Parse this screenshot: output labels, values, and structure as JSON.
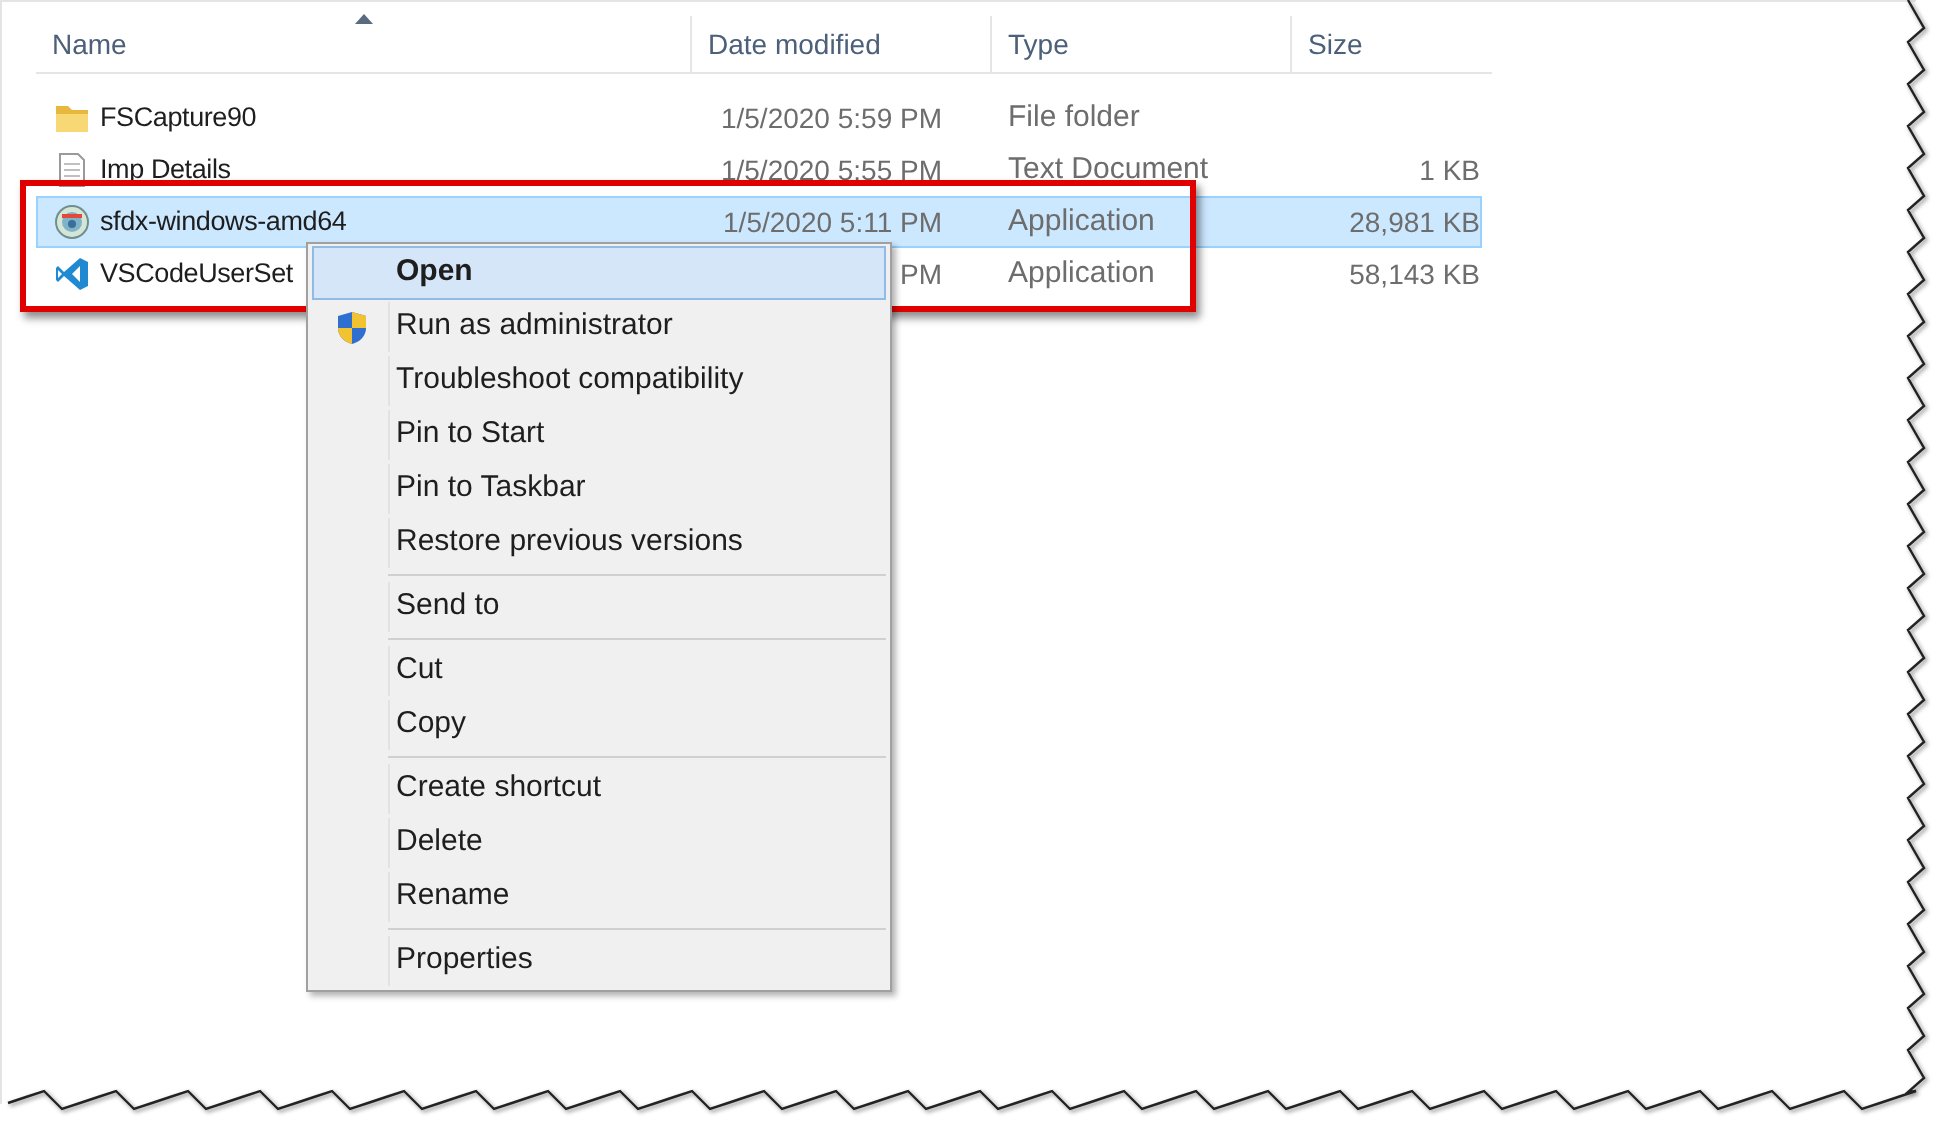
{
  "columns": [
    {
      "label": "Name",
      "sorted": true
    },
    {
      "label": "Date modified",
      "sorted": false
    },
    {
      "label": "Type",
      "sorted": false
    },
    {
      "label": "Size",
      "sorted": false
    }
  ],
  "rows": [
    {
      "kind": "folder",
      "name": "FSCapture90",
      "date": "1/5/2020 5:59 PM",
      "type": "File folder",
      "size": "",
      "selected": false
    },
    {
      "kind": "text",
      "name": "Imp Details",
      "date": "1/5/2020 5:55 PM",
      "type": "Text Document",
      "size": "1 KB",
      "selected": false
    },
    {
      "kind": "installer",
      "name": "sfdx-windows-amd64",
      "date": "1/5/2020 5:11 PM",
      "type": "Application",
      "size": "28,981 KB",
      "selected": true
    },
    {
      "kind": "vscode",
      "name": "VSCodeUserSet",
      "date": "PM",
      "type": "Application",
      "size": "58,143 KB",
      "selected": false
    }
  ],
  "context_menu": [
    {
      "kind": "item",
      "label": "Open",
      "default": true,
      "selected": true
    },
    {
      "kind": "item",
      "label": "Run as administrator",
      "elevated": true,
      "selected": false
    },
    {
      "kind": "item",
      "label": "Troubleshoot compatibility",
      "selected": false
    },
    {
      "kind": "item",
      "label": "Pin to Start",
      "selected": false
    },
    {
      "kind": "item",
      "label": "Pin to Taskbar",
      "selected": false
    },
    {
      "kind": "item",
      "label": "Restore previous versions",
      "selected": false
    },
    {
      "kind": "separator"
    },
    {
      "kind": "item",
      "label": "Send to",
      "selected": false
    },
    {
      "kind": "separator"
    },
    {
      "kind": "item",
      "label": "Cut",
      "selected": false
    },
    {
      "kind": "item",
      "label": "Copy",
      "selected": false
    },
    {
      "kind": "separator"
    },
    {
      "kind": "item",
      "label": "Create shortcut",
      "selected": false
    },
    {
      "kind": "item",
      "label": "Delete",
      "selected": false
    },
    {
      "kind": "item",
      "label": "Rename",
      "selected": false
    },
    {
      "kind": "separator"
    },
    {
      "kind": "item",
      "label": "Properties",
      "selected": false
    }
  ],
  "annotation": {
    "kind": "highlight-box",
    "color": "#e00000"
  }
}
